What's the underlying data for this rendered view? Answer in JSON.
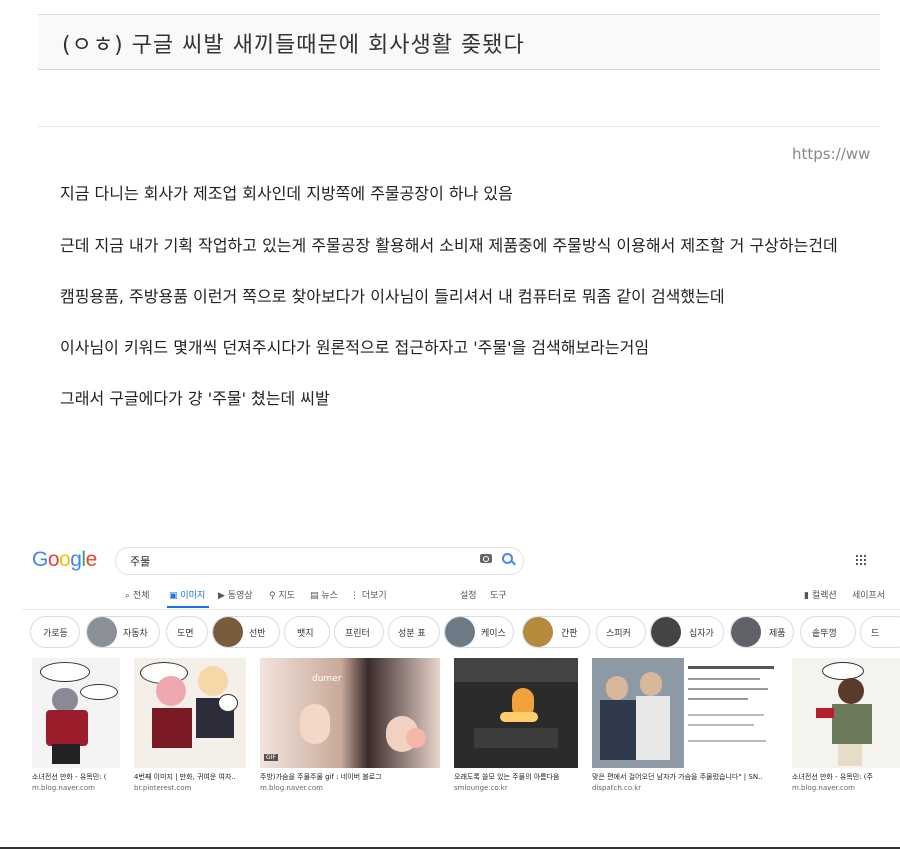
{
  "post": {
    "title": "(ㅇㅎ) 구글 씨발 새끼들때문에 회사생활 좆됐다",
    "url_fragment": "https://ww",
    "paragraphs": [
      "지금 다니는 회사가 제조업 회사인데 지방쪽에 주물공장이 하나 있음",
      "근데 지금 내가 기획 작업하고 있는게 주물공장 활용해서 소비재 제품중에 주물방식 이용해서 제조할 거 구상하는건데",
      "캠핑용품, 주방용품 이런거 쪽으로 찾아보다가 이사님이 들리셔서 내 컴퓨터로 뭐좀 같이 검색했는데",
      "이사님이 키워드 몇개씩 던져주시다가 원론적으로 접근하자고 '주물'을 검색해보라는거임",
      "그래서 구글에다가 걍 '주물' 쳤는데 씨발"
    ]
  },
  "google": {
    "logo": "Google",
    "logo_colors": [
      "#4285f4",
      "#ea4335",
      "#fbbc05",
      "#4285f4",
      "#34a853",
      "#ea4335"
    ],
    "query": "주물",
    "tabs": [
      "전체",
      "이미지",
      "동영상",
      "지도",
      "뉴스",
      "더보기"
    ],
    "tab_icons": [
      "search-icon",
      "image-icon",
      "video-icon",
      "map-pin-icon",
      "news-icon",
      "more-icon"
    ],
    "active_tab": "이미지",
    "settings": "설정",
    "tools": "도구",
    "collection": "컬렉션",
    "safesearch": "세이프서",
    "chips": [
      "가로등",
      "자동차",
      "도면",
      "선반",
      "뱃지",
      "프린터",
      "성분 표",
      "케이스",
      "간판",
      "스피커",
      "십자가",
      "제품",
      "솥뚜껑",
      "드"
    ],
    "results": [
      {
        "title": "소녀전선 만화 - 유목민: (",
        "source": "m.blog.naver.com"
      },
      {
        "title": "4번째 이미지 | 만화, 귀여운 여자..",
        "source": "br.pinterest.com"
      },
      {
        "title": "주방)가슴을 주물주물 gif : 네이버 블로그",
        "source": "m.blog.naver.com",
        "badge": "GIF",
        "watermark": "dumer"
      },
      {
        "title": "오래도록 쓸모 있는 주물의 아름다움",
        "source": "smlounge.co.kr"
      },
      {
        "title": "맞은 편에서 걸어오던 남자가 가슴을 주물렀습니다\" | SN..",
        "source": "dispatch.co.kr"
      },
      {
        "title": "소녀전선 만화 - 유목민: (주",
        "source": "m.blog.naver.com"
      }
    ]
  }
}
